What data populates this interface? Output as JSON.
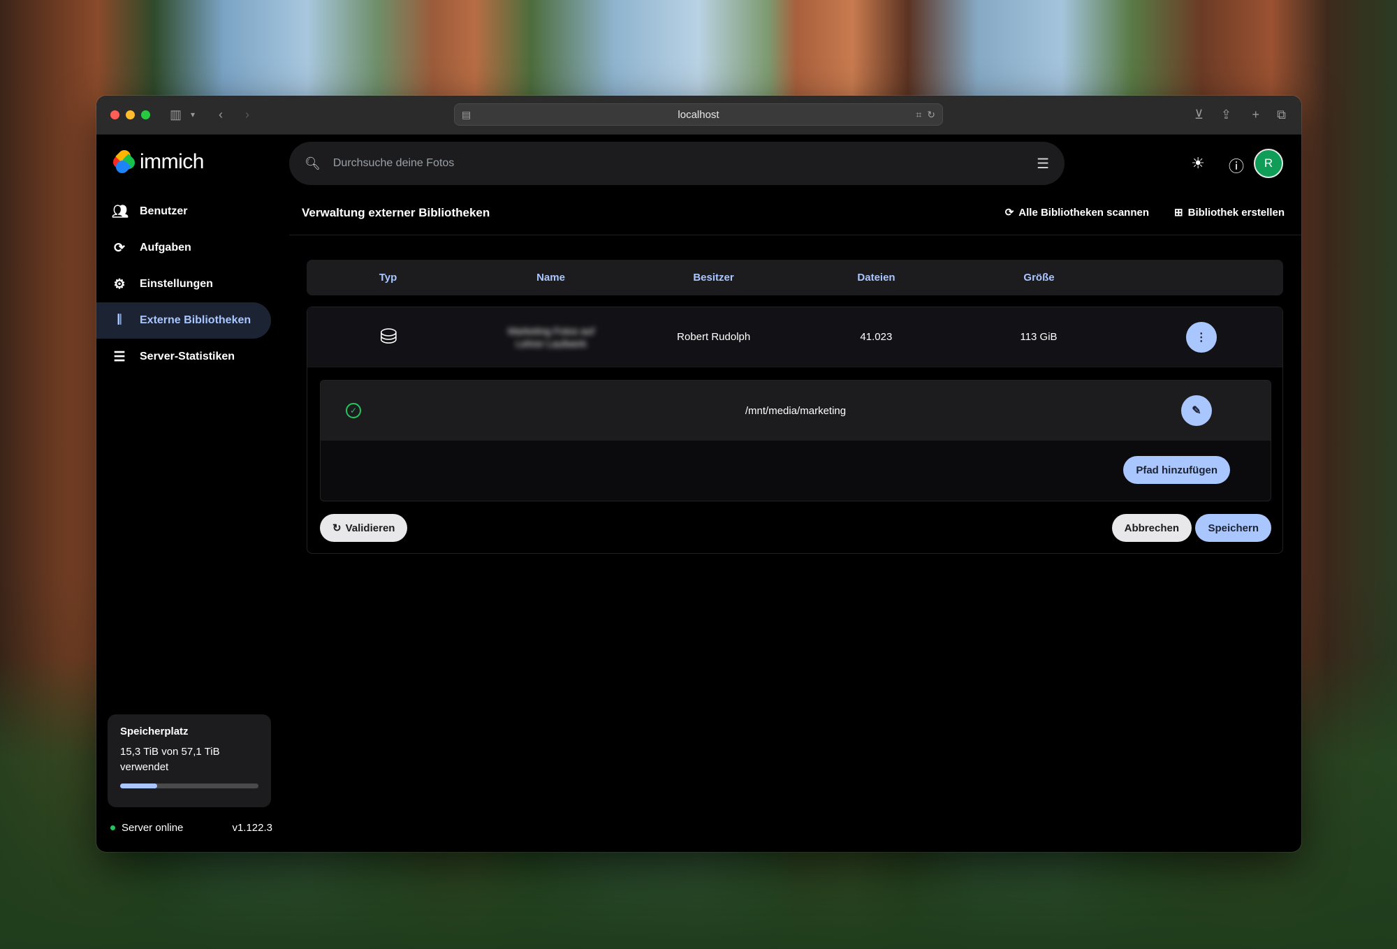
{
  "browser": {
    "url": "localhost"
  },
  "app": {
    "logo_text": "immich",
    "search_placeholder": "Durchsuche deine Fotos",
    "avatar_initial": "R"
  },
  "sidebar": {
    "items": [
      {
        "label": "Benutzer",
        "icon": "users-icon"
      },
      {
        "label": "Aufgaben",
        "icon": "sync-icon"
      },
      {
        "label": "Einstellungen",
        "icon": "gear-icon"
      },
      {
        "label": "Externe Bibliotheken",
        "icon": "library-icon"
      },
      {
        "label": "Server-Statistiken",
        "icon": "server-icon"
      }
    ],
    "storage": {
      "title": "Speicherplatz",
      "text": "15,3 TiB von 57,1 TiB verwendet",
      "used_fraction": 0.268
    },
    "server_status": "Server online",
    "version": "v1.122.3"
  },
  "main": {
    "title": "Verwaltung externer Bibliotheken",
    "scan_all_label": "Alle Bibliotheken scannen",
    "create_label": "Bibliothek erstellen",
    "table": {
      "columns": [
        "Typ",
        "Name",
        "Besitzer",
        "Dateien",
        "Größe"
      ],
      "rows": [
        {
          "name": "Marketing Fotos auf Lehrer Laufwerk",
          "owner": "Robert Rudolph",
          "files": "41.023",
          "size": "113 GiB"
        }
      ]
    },
    "paths": [
      "/mnt/media/marketing"
    ],
    "add_path_label": "Pfad hinzufügen",
    "validate_label": "Validieren",
    "cancel_label": "Abbrechen",
    "save_label": "Speichern"
  },
  "colors": {
    "accent": "#aac6ff",
    "success": "#22c55e",
    "avatar": "#0f9d58"
  }
}
